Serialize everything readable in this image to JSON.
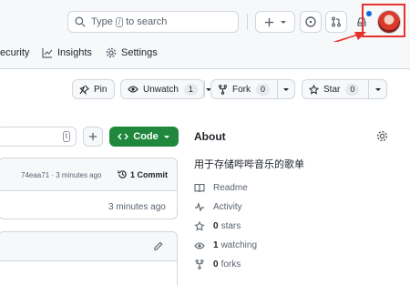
{
  "header": {
    "search_prefix": "Type",
    "search_key": "/",
    "search_suffix": "to search"
  },
  "tabs": [
    {
      "label": "ecurity"
    },
    {
      "label": "Insights"
    },
    {
      "label": "Settings"
    }
  ],
  "actions": {
    "pin": {
      "label": "Pin"
    },
    "watch": {
      "label": "Unwatch",
      "count": "1"
    },
    "fork": {
      "label": "Fork",
      "count": "0"
    },
    "star": {
      "label": "Star",
      "count": "0"
    }
  },
  "code": {
    "file_shortcut": "t",
    "code_button": "Code",
    "commit_hash_time": "74eaa71 · 3 minutes ago",
    "commit_count": "1 Commit",
    "row_time": "3 minutes ago"
  },
  "about": {
    "title": "About",
    "description": "用于存储哔哔音乐的歌单",
    "items": [
      {
        "label": "Readme"
      },
      {
        "label": "Activity"
      },
      {
        "value": "0",
        "label": "stars"
      },
      {
        "value": "1",
        "label": "watching"
      },
      {
        "value": "0",
        "label": "forks"
      }
    ]
  },
  "colors": {
    "accent": "#0969da",
    "code_button": "#1f883d",
    "annotation": "#e5322c"
  }
}
